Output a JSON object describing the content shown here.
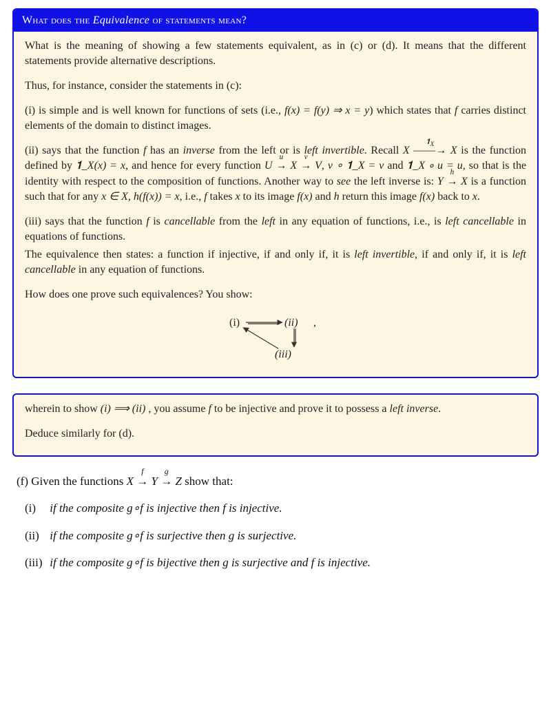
{
  "box1": {
    "title_pre": "What does the ",
    "title_em": "Equivalence",
    "title_post": " of statements mean?",
    "p1": "What is the meaning of showing a few statements equivalent, as in (c) or (d). It means that the different statements provide alternative descriptions.",
    "p2": "Thus, for instance, consider the statements in (c):",
    "p3a": "(i) is simple and is well known for functions of sets (i.e., ",
    "p3_math": "f(x) = f(y) ⇒ x = y",
    "p3b": ") which states that ",
    "p3c": " carries distinct elements of the domain to distinct images.",
    "p4a": "(ii) says that the function ",
    "p4b": " has an ",
    "p4_inv": "inverse",
    "p4c": " from the left or is ",
    "p4_left": "left invertible",
    "p4d": ". Recall ",
    "p4e": " is the function defined by ",
    "p4_math1": "𝟏_X(x) = x",
    "p4f": ", and hence for every function ",
    "p4g": ", ",
    "p4_math2": "v ∘ 𝟏_X = v",
    "p4h": " and ",
    "p4_math3": "𝟏_X ∘ u = u",
    "p4i": ", so that is the identity with respect to the composition of functions. Another way to ",
    "p4_see": "see",
    "p4j": " the left inverse is: ",
    "p4k": " is a function such that for any ",
    "p4_math4": "x ∈ X, h(f(x)) = x",
    "p4l": ", i.e., ",
    "p4m": " takes ",
    "p4n": " to its image ",
    "p4o": " and ",
    "p4p": " return this image ",
    "p4q": " back to ",
    "p5a": "(iii) says that the function ",
    "p5b": " is ",
    "p5_canc": "cancellable",
    "p5c": " from the ",
    "p5_left": "left",
    "p5d": " in any equation of functions, i.e., is ",
    "p5_lc": "left cancellable",
    "p5e": " in equations of functions.",
    "p6a": "The equivalence then states: a function if injective, if and only if, it is ",
    "p6_li": "left invertible",
    "p6b": ", if and only if, it is ",
    "p6_lc": "left cancellable",
    "p6c": " in any equation of functions.",
    "p7": "How does one prove such equivalences? You show:",
    "diagram": {
      "i": "(i)",
      "ii": "(ii)",
      "iii": "(iii)",
      "comma": ","
    }
  },
  "box2": {
    "p1a": "wherein to show ",
    "p1_math": "(i) ⟹ (ii)",
    "p1b": " , you assume ",
    "p1c": " to be injective and prove it to possess a ",
    "p1_left": "left inverse",
    "p1d": ".",
    "p2": "Deduce similarly for (d)."
  },
  "f": {
    "lead_a": "(f)  Given the functions ",
    "lead_b": " show that:",
    "i": "if the composite g∘f is injective then f is injective.",
    "ii": "if the composite g∘f is surjective then g is surjective.",
    "iii": "if the composite g∘f is bijective then g is surjective and f is injective.",
    "lbl_i": "(i)",
    "lbl_ii": "(ii)",
    "lbl_iii": "(iii)"
  },
  "sym": {
    "f": "f",
    "g": "g",
    "h": "h",
    "x": "x",
    "X": "X",
    "Y": "Y",
    "Z": "Z",
    "U": "U",
    "V": "V",
    "fx": "f(x)",
    "oneX": "𝟏",
    "sub": "X",
    "u": "u",
    "v": "v",
    "dot": "."
  }
}
